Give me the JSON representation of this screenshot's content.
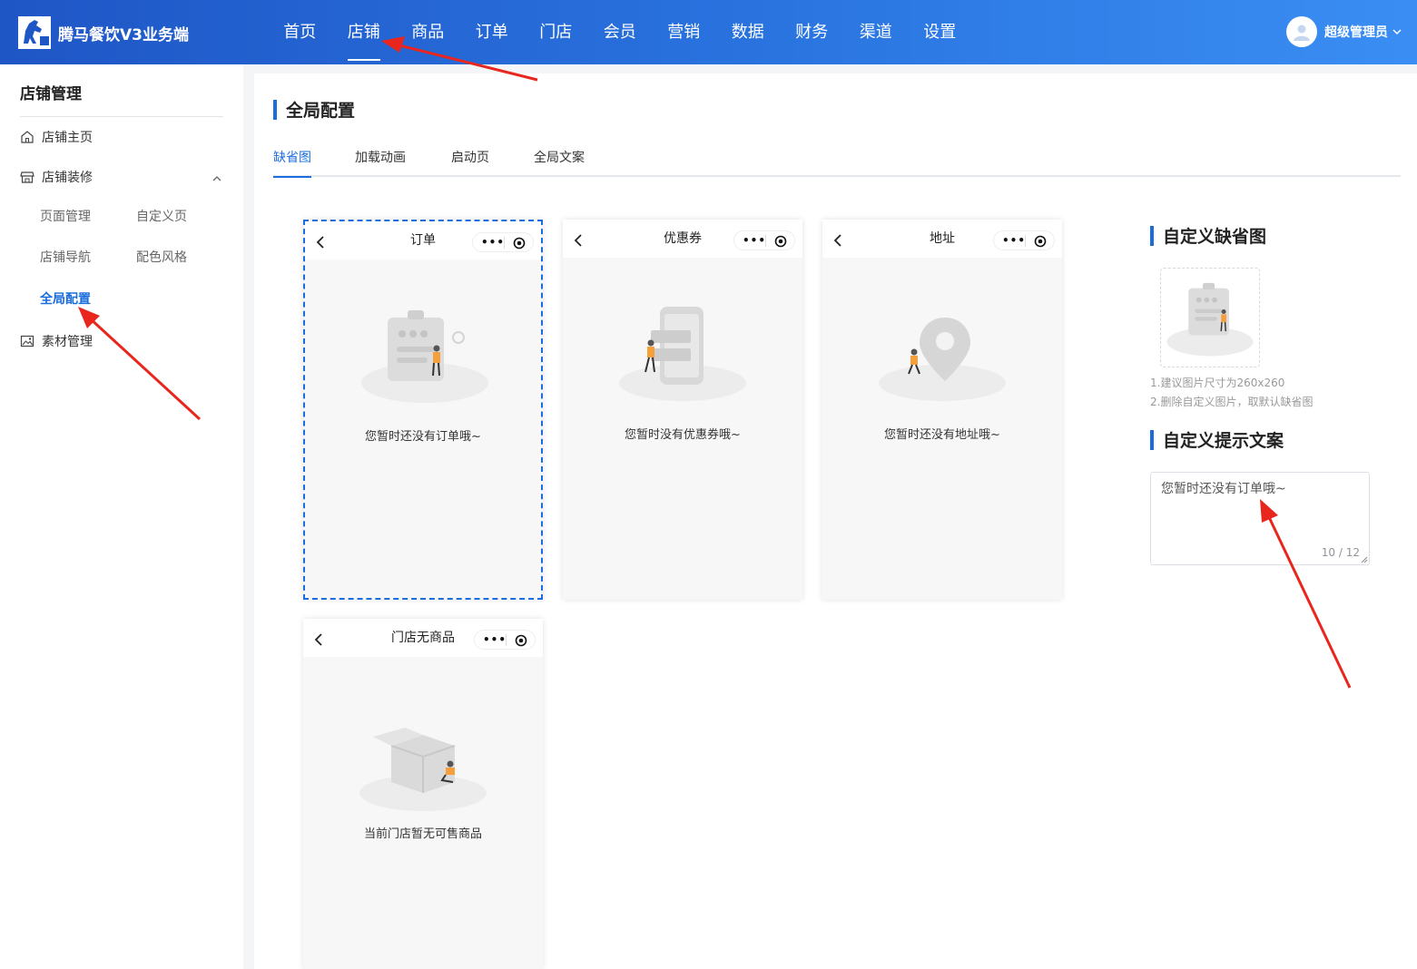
{
  "app": {
    "name": "腾马餐饮V3业务端"
  },
  "topnav": [
    {
      "label": "首页"
    },
    {
      "label": "店铺"
    },
    {
      "label": "商品"
    },
    {
      "label": "订单"
    },
    {
      "label": "门店"
    },
    {
      "label": "会员"
    },
    {
      "label": "营销"
    },
    {
      "label": "数据"
    },
    {
      "label": "财务"
    },
    {
      "label": "渠道"
    },
    {
      "label": "设置"
    }
  ],
  "topnav_active_index": 1,
  "user": {
    "name": "超级管理员"
  },
  "sidebar": {
    "title": "店铺管理",
    "items": {
      "home": "店铺主页",
      "decor": "店铺装修",
      "page_mgmt": "页面管理",
      "custom_page": "自定义页",
      "shop_nav": "店铺导航",
      "color_style": "配色风格",
      "global_config": "全局配置",
      "material": "素材管理"
    }
  },
  "main": {
    "title": "全局配置",
    "tabs": [
      {
        "label": "缺省图"
      },
      {
        "label": "加载动画"
      },
      {
        "label": "启动页"
      },
      {
        "label": "全局文案"
      }
    ],
    "active_tab": 0
  },
  "phones": [
    {
      "title": "订单",
      "text": "您暂时还没有订单哦~"
    },
    {
      "title": "优惠券",
      "text": "您暂时没有优惠券哦~"
    },
    {
      "title": "地址",
      "text": "您暂时还没有地址哦~"
    },
    {
      "title": "门店无商品",
      "text": "当前门店暂无可售商品"
    }
  ],
  "right_panel": {
    "image_title": "自定义缺省图",
    "hint1": "1.建议图片尺寸为260x260",
    "hint2": "2.删除自定义图片，取默认缺省图",
    "text_title": "自定义提示文案",
    "text_value": "您暂时还没有订单哦~",
    "counter": "10 / 12"
  },
  "colors": {
    "accent": "#1a6ddd",
    "header_start": "#1f56c6",
    "header_end": "#3a8ef3",
    "arrow": "#e8261d"
  }
}
